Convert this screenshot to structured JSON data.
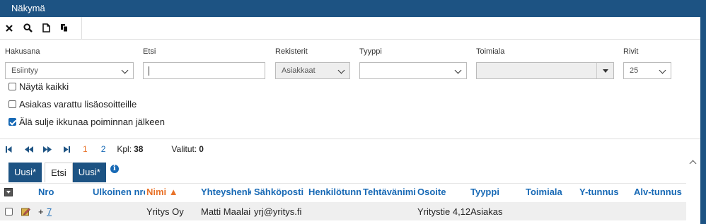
{
  "window": {
    "title": "Näkymä"
  },
  "toolbar": {
    "icons": [
      "close-icon",
      "search-icon",
      "new-document-icon",
      "copy-icon"
    ]
  },
  "filters": {
    "hakusana": {
      "label": "Hakusana",
      "value": "Esiintyy"
    },
    "etsi": {
      "label": "Etsi",
      "value": ""
    },
    "rekisterit": {
      "label": "Rekisterit",
      "value": "Asiakkaat"
    },
    "tyyppi": {
      "label": "Tyyppi",
      "value": ""
    },
    "toimiala": {
      "label": "Toimiala",
      "value": ""
    },
    "rivit": {
      "label": "Rivit",
      "value": "25"
    }
  },
  "options": {
    "show_all": {
      "label": "Näytä kaikki",
      "checked": false
    },
    "reserved": {
      "label": "Asiakas varattu lisäosoitteille",
      "checked": false
    },
    "keep_open": {
      "label": "Älä sulje ikkunaa poiminnan jälkeen",
      "checked": true
    }
  },
  "pager": {
    "pages": [
      "1",
      "2"
    ],
    "current_page": "1",
    "count_label": "Kpl:",
    "count": "38",
    "selected_label": "Valitut:",
    "selected": "0"
  },
  "tabs": [
    {
      "label": "Uusi*"
    },
    {
      "label": "Etsi"
    },
    {
      "label": "Uusi*"
    }
  ],
  "info_glyph": "i",
  "table": {
    "columns": [
      "Nro",
      "Ulkoinen nro",
      "Nimi ▲",
      "Yhteyshenkilö",
      "Sähköposti",
      "Henkilötunnus",
      "Tehtävänimike",
      "Osoite",
      "Tyyppi",
      "Toimiala",
      "Y-tunnus",
      "Alv-tunnus"
    ],
    "sorted_column": "Nimi",
    "rows": [
      {
        "expand": "+",
        "nro": "7",
        "ulkoinen_nro": "",
        "nimi": "Yritys Oy",
        "yhteyshenkilo": "Matti Maalai",
        "sahkoposti": "yrj@yritys.fi",
        "henkilotunnus": "",
        "tehtavanimike": "",
        "osoite": "Yritystie 4,12",
        "tyyppi": "Asiakas",
        "toimiala": "",
        "y_tunnus": "",
        "alv_tunnus": ""
      }
    ]
  }
}
